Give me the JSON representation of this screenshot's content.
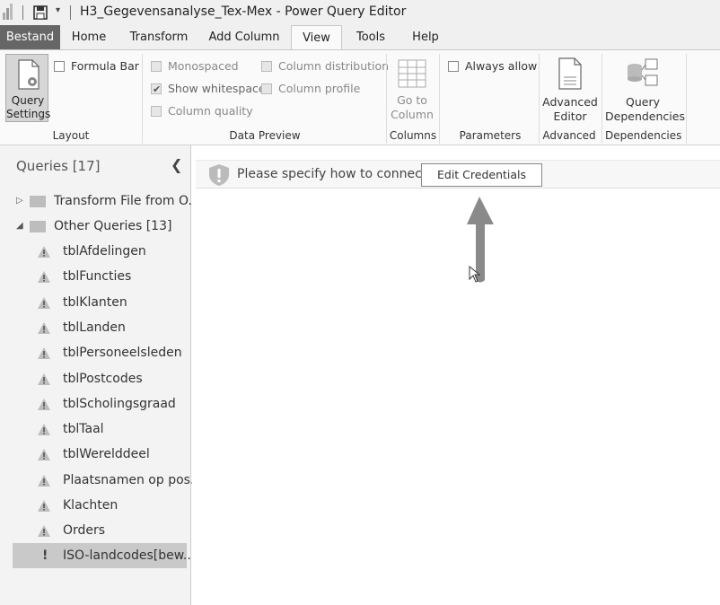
{
  "window": {
    "title": "H3_Gegevensanalyse_Tex-Mex - Power Query Editor",
    "qat_dropdown": "▾"
  },
  "tabs": [
    "Bestand",
    "Home",
    "Transform",
    "Add Column",
    "View",
    "Tools",
    "Help"
  ],
  "ribbon": {
    "layout": {
      "query_settings_line1": "Query",
      "query_settings_line2": "Settings",
      "formula_bar": "Formula Bar",
      "group": "Layout"
    },
    "data_preview": {
      "monospaced": "Monospaced",
      "show_whitespace": "Show whitespace",
      "column_quality": "Column quality",
      "column_distribution": "Column distribution",
      "column_profile": "Column profile",
      "group": "Data Preview",
      "show_whitespace_checked": true
    },
    "columns": {
      "goto_line1": "Go to",
      "goto_line2": "Column",
      "group": "Columns"
    },
    "parameters": {
      "always_allow": "Always allow",
      "group": "Parameters"
    },
    "advanced": {
      "line1": "Advanced",
      "line2": "Editor",
      "group": "Advanced"
    },
    "dependencies": {
      "line1": "Query",
      "line2": "Dependencies",
      "group": "Dependencies"
    }
  },
  "queries_pane": {
    "header": "Queries [17]",
    "folders": [
      {
        "label": "Transform File from O...",
        "expanded": false
      },
      {
        "label": "Other Queries [13]",
        "expanded": true
      }
    ],
    "items": [
      "tblAfdelingen",
      "tblFuncties",
      "tblKlanten",
      "tblLanden",
      "tblPersoneelsleden",
      "tblPostcodes",
      "tblScholingsgraad",
      "tblTaal",
      "tblWerelddeel",
      "Plaatsnamen op pos...",
      "Klachten",
      "Orders"
    ],
    "selected_item": "ISO-landcodes[bew...",
    "selected_marker": "!"
  },
  "main": {
    "info_text": "Please specify how to connect.",
    "edit_credentials": "Edit Credentials"
  },
  "colors": {
    "file_tab_bg": "#666666",
    "arrow": "#8a8a8a",
    "selected_row": "#c9c9c9"
  }
}
